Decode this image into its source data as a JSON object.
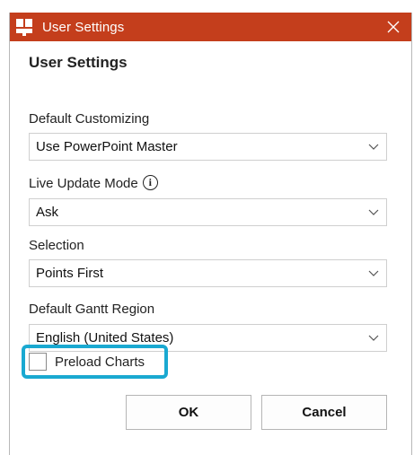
{
  "window": {
    "title": "User Settings",
    "titlebar_color": "#c43e1c",
    "app_icon": "powerpoint-addin-icon",
    "close_icon": "close-icon"
  },
  "dialog": {
    "heading": "User Settings",
    "fields": [
      {
        "label": "Default Customizing",
        "value": "Use PowerPoint Master"
      },
      {
        "label": "Live Update Mode",
        "value": "Ask",
        "has_info_icon": true
      },
      {
        "label": "Selection",
        "value": "Points First"
      },
      {
        "label": "Default Gantt Region",
        "value": "English (United States)"
      }
    ],
    "preload_charts": {
      "label": "Preload Charts",
      "checked": false,
      "highlight_color": "#1aa9d1"
    },
    "buttons": {
      "ok": "OK",
      "cancel": "Cancel"
    }
  }
}
